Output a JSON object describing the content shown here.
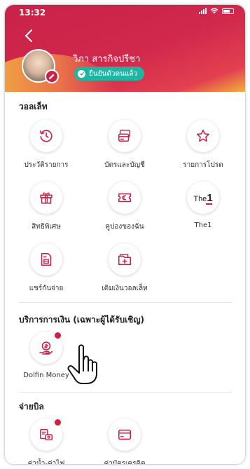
{
  "status": {
    "time": "13:32"
  },
  "profile": {
    "name": "วิภา สารกิจปรีชา",
    "verified_label": "ยืนยันตัวตนแล้ว"
  },
  "wallet": {
    "title": "วอลเล็ท",
    "items": [
      {
        "label": "ประวัติรายการ",
        "icon": "history-icon"
      },
      {
        "label": "บัตรและบัญชี",
        "icon": "cards-icon"
      },
      {
        "label": "รายการโปรด",
        "icon": "star-icon"
      },
      {
        "label": "สิทธิพิเศษ",
        "icon": "gift-icon"
      },
      {
        "label": "คูปองของฉัน",
        "icon": "coupon-icon"
      },
      {
        "label": "The1",
        "icon": "the1-logo"
      },
      {
        "label": "แชร์กันจ่าย",
        "icon": "split-bill-icon"
      },
      {
        "label": "เติมเงินวอลเล็ท",
        "icon": "topup-wallet-icon"
      }
    ]
  },
  "finance": {
    "title": "บริการการเงิน (เฉพาะผู้ได้รับเชิญ)",
    "items": [
      {
        "label": "Dolfin Money",
        "icon": "money-icon"
      }
    ]
  },
  "bills": {
    "title": "จ่ายบิล",
    "items": [
      {
        "label": "ค่าน้ำ-ค่าไฟ",
        "icon": "utility-bill-icon"
      },
      {
        "label": "ค่าบัตรเครดิต",
        "icon": "credit-card-icon"
      }
    ]
  },
  "the1_logo": {
    "text": "The",
    "numeral": "1"
  },
  "colors": {
    "brand": "#c92249",
    "verified": "#1fb5a3",
    "badge": "#d11f3c"
  }
}
